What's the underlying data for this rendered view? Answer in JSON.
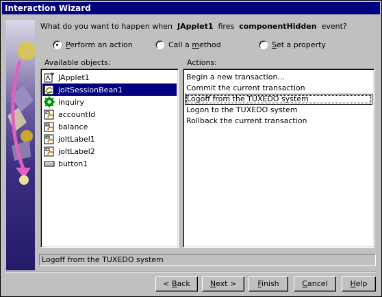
{
  "window": {
    "title": "Interaction Wizard"
  },
  "question": {
    "prefix": "What do you want to happen when",
    "source": "JApplet1",
    "verb": "fires",
    "event": "componentHidden",
    "suffix": "event?"
  },
  "options": [
    {
      "underline": "P",
      "rest": "erform an action",
      "selected": true
    },
    {
      "prefix": "Call a ",
      "underline": "m",
      "rest": "ethod",
      "selected": false
    },
    {
      "underline": "S",
      "rest": "et a property",
      "selected": false
    }
  ],
  "objects": {
    "label": "Available objects:",
    "items": [
      {
        "label": "JApplet1",
        "icon": "applet-icon"
      },
      {
        "label": "joltSessionBean1",
        "icon": "bean-icon",
        "selected": true
      },
      {
        "label": "inquiry",
        "icon": "gear-icon"
      },
      {
        "label": "accountId",
        "icon": "bean-field-icon"
      },
      {
        "label": "balance",
        "icon": "bean-field-icon"
      },
      {
        "label": "joltLabel1",
        "icon": "bean-field-icon"
      },
      {
        "label": "joltLabel2",
        "icon": "bean-field-icon"
      },
      {
        "label": "button1",
        "icon": "button-icon"
      }
    ]
  },
  "actions": {
    "label": "Actions:",
    "items": [
      {
        "label": "Begin a new transaction..."
      },
      {
        "label": "Commit the current transaction"
      },
      {
        "label": "Logoff from the TUXEDO system",
        "focused": true
      },
      {
        "label": "Logon to the TUXEDO system"
      },
      {
        "label": "Rollback the current transaction"
      }
    ]
  },
  "status": {
    "text": "Logoff from the TUXEDO system"
  },
  "buttons": {
    "back": {
      "pre": "< ",
      "underline": "B",
      "rest": "ack"
    },
    "next": {
      "underline": "N",
      "rest": "ext >"
    },
    "finish": {
      "underline": "F",
      "rest": "inish"
    },
    "cancel": {
      "underline": "C",
      "rest": "ancel"
    },
    "help": {
      "underline": "H",
      "rest": "elp"
    }
  },
  "colors": {
    "titlebar": "#000080",
    "selection": "#000080",
    "face": "#c0c0c0"
  }
}
